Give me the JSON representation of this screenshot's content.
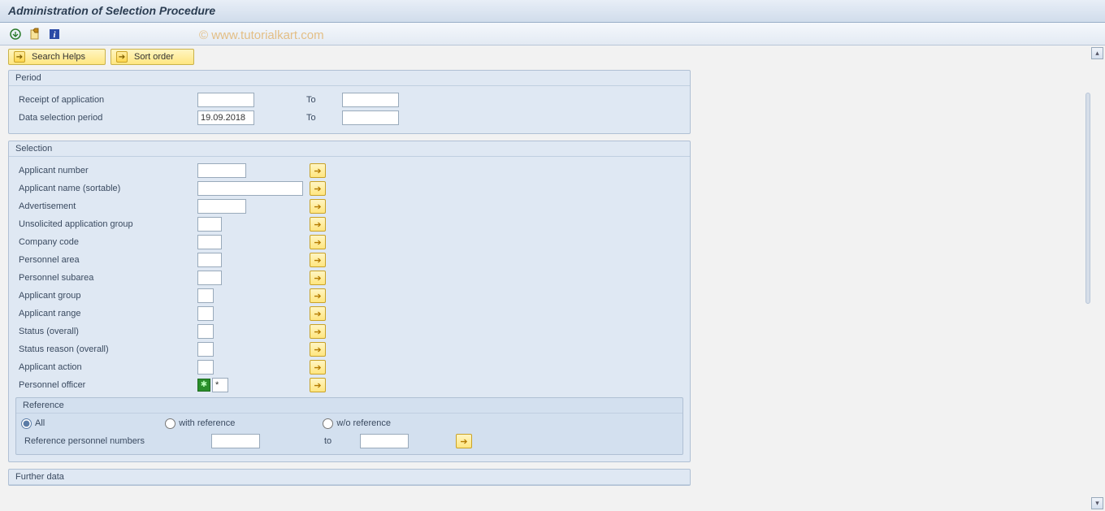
{
  "title": "Administration of Selection Procedure",
  "watermark": "© www.tutorialkart.com",
  "toolbar_buttons": {
    "search_helps": "Search Helps",
    "sort_order": "Sort order"
  },
  "groups": {
    "period": {
      "title": "Period",
      "rows": [
        {
          "label": "Receipt of application",
          "from": "",
          "to_label": "To",
          "to": ""
        },
        {
          "label": "Data selection period",
          "from": "19.09.2018",
          "to_label": "To",
          "to": ""
        }
      ]
    },
    "selection": {
      "title": "Selection",
      "rows": [
        {
          "label": "Applicant number",
          "value": "",
          "width": "w60"
        },
        {
          "label": "Applicant name (sortable)",
          "value": "",
          "width": "w130"
        },
        {
          "label": "Advertisement",
          "value": "",
          "width": "w60"
        },
        {
          "label": "Unsolicited application group",
          "value": "",
          "width": "w30"
        },
        {
          "label": "Company code",
          "value": "",
          "width": "w30"
        },
        {
          "label": "Personnel area",
          "value": "",
          "width": "w30"
        },
        {
          "label": "Personnel subarea",
          "value": "",
          "width": "w30"
        },
        {
          "label": "Applicant group",
          "value": "",
          "width": "w20"
        },
        {
          "label": "Applicant range",
          "value": "",
          "width": "w20"
        },
        {
          "label": "Status (overall)",
          "value": "",
          "width": "w20"
        },
        {
          "label": "Status reason (overall)",
          "value": "",
          "width": "w20"
        },
        {
          "label": "Applicant action",
          "value": "",
          "width": "w20"
        },
        {
          "label": "Personnel officer",
          "value": "*",
          "width": "w20",
          "has_indicator": true
        }
      ],
      "reference": {
        "title": "Reference",
        "radios": {
          "all": "All",
          "with_ref": "with reference",
          "wo_ref": "w/o reference"
        },
        "ref_num_label": "Reference personnel numbers",
        "ref_to_label": "to"
      }
    },
    "further": {
      "title": "Further data"
    }
  }
}
